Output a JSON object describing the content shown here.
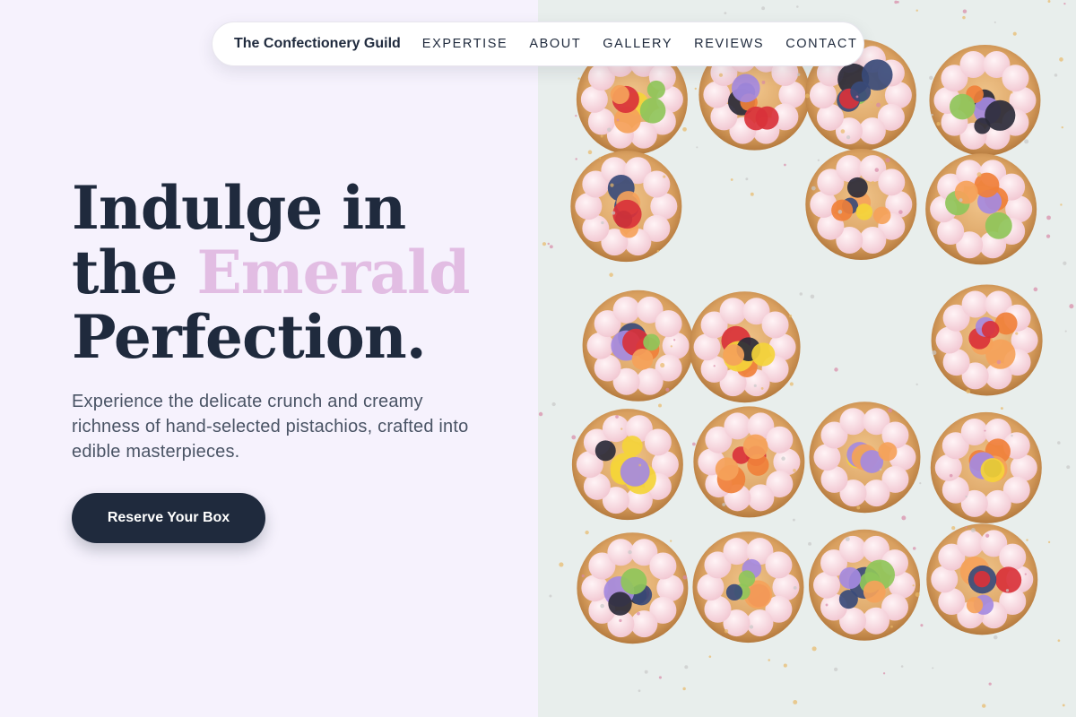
{
  "nav": {
    "brand": "The Confectionery Guild",
    "links": [
      "EXPERTISE",
      "ABOUT",
      "GALLERY",
      "REVIEWS",
      "CONTACT"
    ]
  },
  "hero": {
    "line1": "Indulge in",
    "line2_prefix": "the ",
    "line2_accent": "Emerald",
    "line3": "Perfection.",
    "subtitle": "Experience the delicate crunch and creamy richness of hand-selected pistachios, crafted into edible masterpieces.",
    "cta_label": "Reserve Your Box"
  },
  "colors": {
    "background_left": "#f6f2fd",
    "background_right": "#e9efee",
    "text_dark": "#1f2a3d",
    "accent_pink": "#e2bde3",
    "button": "#1f2a3d"
  },
  "image": {
    "subject": "pastry-tarts-photo"
  }
}
